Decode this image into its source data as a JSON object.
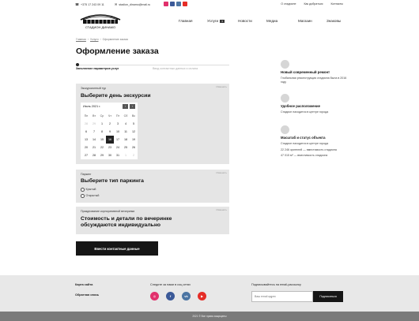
{
  "topbar": {
    "phone": "+375 17 243 09 11",
    "email": "stadion_dinamo@mail.ru",
    "socials": [
      "instagram",
      "facebook",
      "vk",
      "youtube"
    ],
    "social_colors": [
      "#e1306c",
      "#3b5998",
      "#4c75a3",
      "#e52d27"
    ],
    "links": [
      "О стадионе",
      "Как добраться",
      "Контакты"
    ]
  },
  "header": {
    "logo_text": "СТАДИОН ДИНАМО",
    "nav": [
      "Главная",
      "Услуги",
      "Новости",
      "Медиа",
      "Магазин",
      "Знаковы"
    ]
  },
  "breadcrumb": [
    "Главная",
    "Услуги",
    "Оформление заказа"
  ],
  "page_title": "Оформление заказа",
  "steps": [
    {
      "label": "Заполнение параметров услуг",
      "active": true
    },
    {
      "label": "Ввод контактных данных и оплата",
      "active": false
    }
  ],
  "excursion": {
    "tag": "Экскурсионный тур",
    "heading": "Выберите день экскурсии",
    "edit": "Изменить",
    "calendar": {
      "month": "Июль 2021 г.",
      "days": [
        "Пн",
        "Вт",
        "Ср",
        "Чт",
        "Пт",
        "Сб",
        "Вс"
      ],
      "rows": [
        [
          "28",
          "29",
          "1",
          "2",
          "3",
          "4",
          "5"
        ],
        [
          "6",
          "7",
          "8",
          "9",
          "10",
          "11",
          "12"
        ],
        [
          "13",
          "14",
          "15",
          "16",
          "17",
          "18",
          "19"
        ],
        [
          "20",
          "21",
          "22",
          "23",
          "24",
          "25",
          "26"
        ],
        [
          "27",
          "28",
          "29",
          "30",
          "31",
          "1",
          "2"
        ]
      ],
      "selected": "16"
    }
  },
  "parking": {
    "tag": "Паркинг",
    "heading": "Выберите тип паркинга",
    "edit": "Изменить",
    "options": [
      "Крытый",
      "Открытый"
    ]
  },
  "corporate": {
    "tag": "Празднование корпоративной вечеринки",
    "heading": "Стоимость и детали по вечеринке обсуждаются индивидуально",
    "edit": "Изменить"
  },
  "submit_button": "Ввести контактные данные",
  "sidebar": [
    {
      "title": "Новый современный ремонт",
      "text": [
        "Глобальная реконструкция стадиона была в 2016 году"
      ]
    },
    {
      "title": "Удобное расположение",
      "text": [
        "Стадион находится в центре города"
      ]
    },
    {
      "title": "Масштаб и статус объекта",
      "text": [
        "Стадион находится в центре города",
        "22 246 зрителей — вместимость стадиона",
        "47 015 м² — вместимость стадиона"
      ]
    }
  ],
  "footer": {
    "links": [
      "Карта сайта",
      "Обратная связь"
    ],
    "follow": "Следите за нами в соц сетях",
    "newsletter": "Подписывайтесь на email-рассылку",
    "email_placeholder": "Ваш email адрес",
    "subscribe": "Подписаться",
    "copyright": "2021 © Все права защищены"
  }
}
